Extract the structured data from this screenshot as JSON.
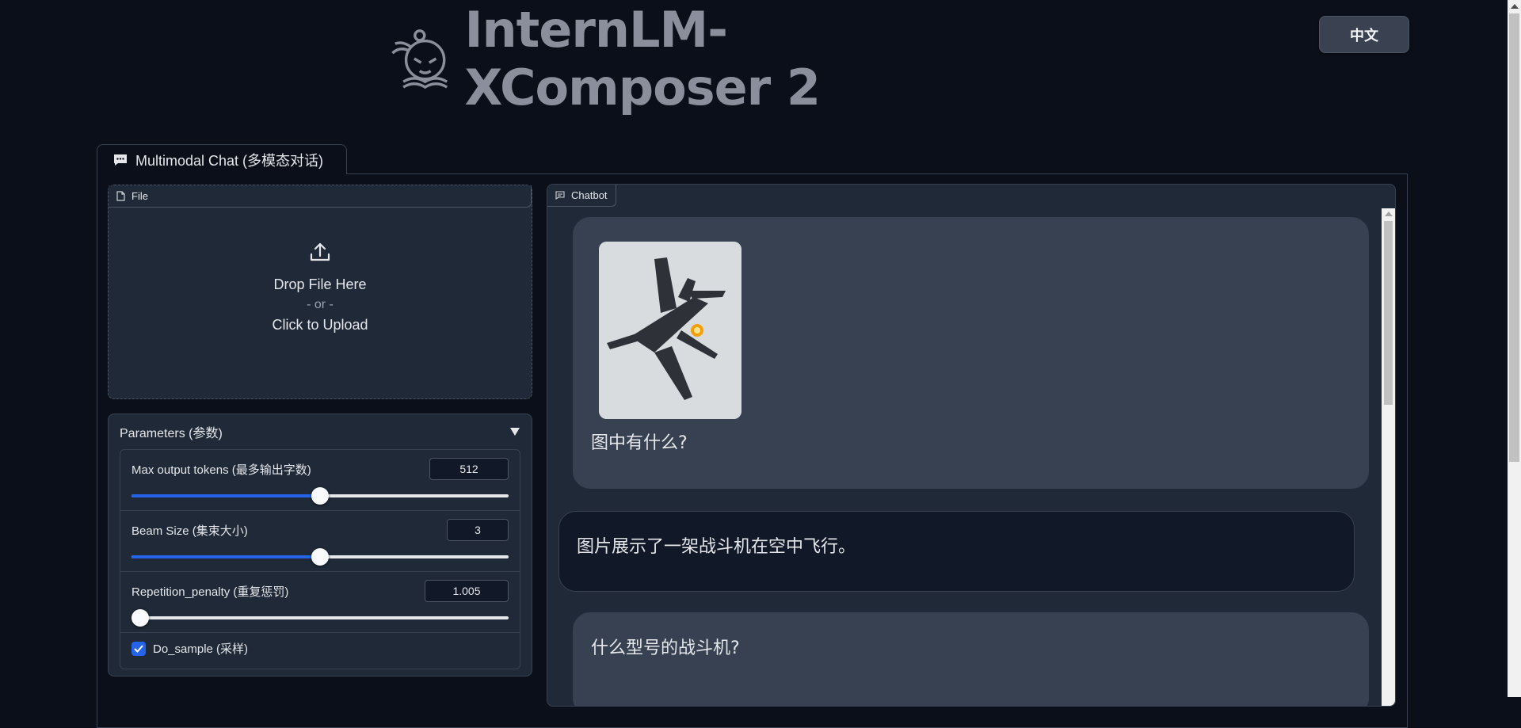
{
  "header": {
    "title": "InternLM-XComposer 2",
    "lang_button": "中文"
  },
  "tabs": [
    {
      "label": "Multimodal Chat (多模态对话)",
      "active": true
    }
  ],
  "file_upload": {
    "label": "File",
    "drop_text": "Drop File Here",
    "or_text": "- or -",
    "click_text": "Click to Upload"
  },
  "parameters": {
    "title": "Parameters (参数)",
    "max_tokens": {
      "label": "Max output tokens (最多输出字数)",
      "value": "512",
      "fraction": 0.5
    },
    "beam_size": {
      "label": "Beam Size (集束大小)",
      "value": "3",
      "fraction": 0.5
    },
    "repetition_penalty": {
      "label": "Repetition_penalty (重复惩罚)",
      "value": "1.005",
      "fraction": 0.0
    },
    "do_sample": {
      "label": "Do_sample (采样)",
      "checked": true
    }
  },
  "chatbot": {
    "label": "Chatbot",
    "messages": [
      {
        "role": "user",
        "text": "图中有什么?",
        "image": "fighter-jet-photo"
      },
      {
        "role": "bot",
        "text": "图片展示了一架战斗机在空中飞行。"
      },
      {
        "role": "user",
        "text": "什么型号的战斗机?"
      }
    ]
  },
  "colors": {
    "background": "#0b0f19",
    "panel": "#1f2937",
    "accent": "#2563eb",
    "user_bubble": "#374151",
    "bot_bubble": "#111827"
  }
}
